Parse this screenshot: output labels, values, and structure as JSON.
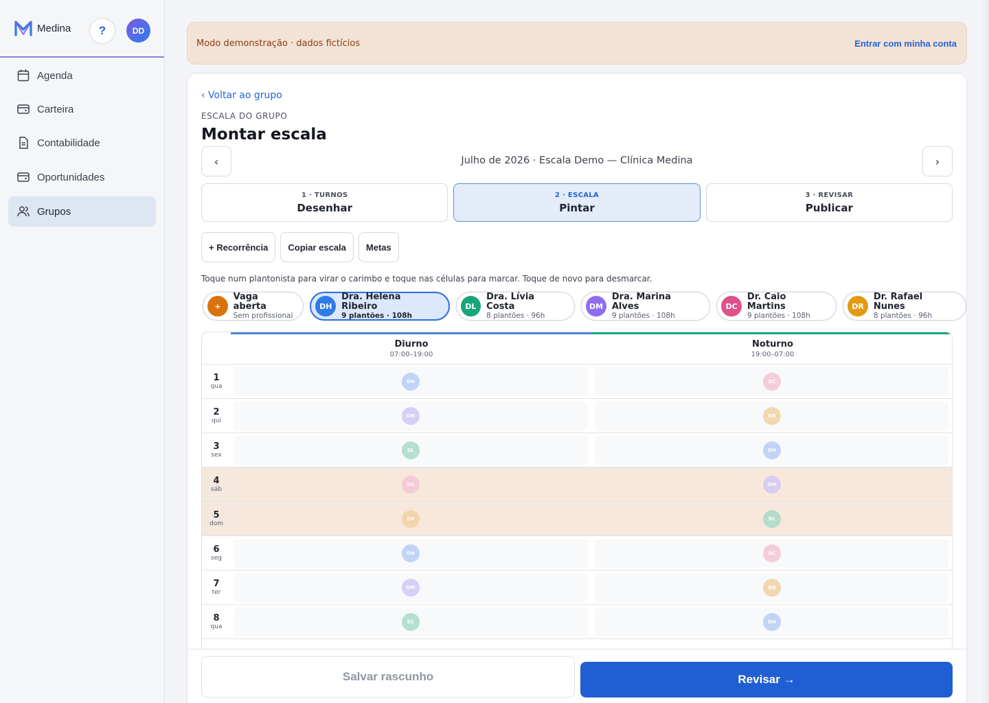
{
  "sidebar": {
    "brand": "Medina",
    "help_label": "?",
    "user_initials": "DD",
    "items": [
      {
        "label": "Agenda",
        "icon": "calendar-icon"
      },
      {
        "label": "Carteira",
        "icon": "wallet-icon"
      },
      {
        "label": "Contabilidade",
        "icon": "document-icon"
      },
      {
        "label": "Oportunidades",
        "icon": "wallet-icon"
      },
      {
        "label": "Grupos",
        "icon": "users-icon",
        "active": true
      }
    ]
  },
  "banner": {
    "text": "Modo demonstração · dados fictícios",
    "link": "Entrar com minha conta"
  },
  "header": {
    "back": "‹ Voltar ao grupo",
    "eyebrow": "ESCALA DO GRUPO",
    "title": "Montar escala",
    "prev": "‹",
    "next": "›",
    "month": "Julho de 2026 · Escala Demo — Clínica Medina"
  },
  "steps": [
    {
      "kicker": "1 · TURNOS",
      "label": "Desenhar",
      "active": false
    },
    {
      "kicker": "2 · ESCALA",
      "label": "Pintar",
      "active": true
    },
    {
      "kicker": "3 · REVISAR",
      "label": "Publicar",
      "active": false
    }
  ],
  "tools": {
    "recurrence": "+ Recorrência",
    "copy": "Copiar escala",
    "goals": "Metas"
  },
  "hint": "Toque num plantonista para virar o carimbo e toque nas células para marcar. Toque de novo para desmarcar.",
  "professionals": [
    {
      "initials": "+",
      "name": "Vaga aberta",
      "sub": "Sem profissional",
      "color": "#d9730d",
      "active": false
    },
    {
      "initials": "DH",
      "name": "Dra. Helena Ribeiro",
      "sub": "9 plantões · 108h",
      "color": "#2f7be8",
      "active": true
    },
    {
      "initials": "DL",
      "name": "Dra. Lívia Costa",
      "sub": "8 plantões · 96h",
      "color": "#17a67a",
      "active": false
    },
    {
      "initials": "DM",
      "name": "Dra. Marina Alves",
      "sub": "9 plantões · 108h",
      "color": "#8f6cf0",
      "active": false
    },
    {
      "initials": "DC",
      "name": "Dr. Caio Martins",
      "sub": "9 plantões · 108h",
      "color": "#e0508a",
      "active": false
    },
    {
      "initials": "DR",
      "name": "Dr. Rafael Nunes",
      "sub": "8 plantões · 96h",
      "color": "#e39a12",
      "active": false
    }
  ],
  "shifts": [
    {
      "name": "Diurno",
      "time": "07:00–19:00",
      "color": "#4a86d8"
    },
    {
      "name": "Noturno",
      "time": "19:00–07:00",
      "color": "#18a882"
    }
  ],
  "stamp_colors": {
    "DH": "#b9cdf6",
    "DL": "#a8dcc8",
    "DM": "#d3c8f6",
    "DC": "#f4c6d6",
    "DR": "#f3d2a2"
  },
  "days": [
    {
      "num": "1",
      "wd": "qua",
      "weekend": false,
      "day": "DH",
      "night": "DC"
    },
    {
      "num": "2",
      "wd": "qui",
      "weekend": false,
      "day": "DM",
      "night": "DR"
    },
    {
      "num": "3",
      "wd": "sex",
      "weekend": false,
      "day": "DL",
      "night": "DH"
    },
    {
      "num": "4",
      "wd": "sáb",
      "weekend": true,
      "day": "DC",
      "night": "DM"
    },
    {
      "num": "5",
      "wd": "dom",
      "weekend": true,
      "day": "DR",
      "night": "DL"
    },
    {
      "num": "6",
      "wd": "seg",
      "weekend": false,
      "day": "DH",
      "night": "DC"
    },
    {
      "num": "7",
      "wd": "ter",
      "weekend": false,
      "day": "DM",
      "night": "DR"
    },
    {
      "num": "8",
      "wd": "qua",
      "weekend": false,
      "day": "DL",
      "night": "DH"
    }
  ],
  "footer": {
    "draft": "Salvar rascunho",
    "review": "Revisar →"
  }
}
